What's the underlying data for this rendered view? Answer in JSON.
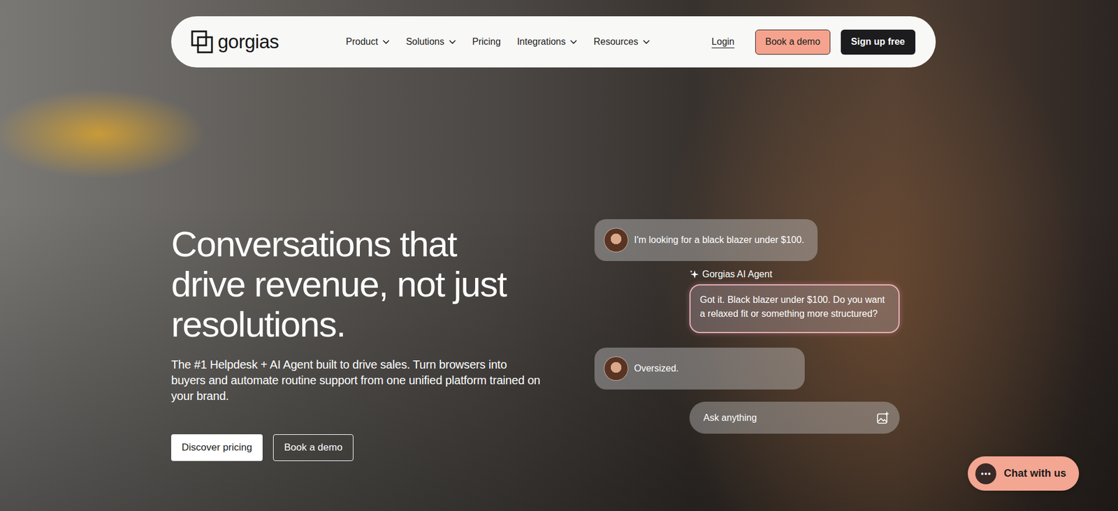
{
  "logo": {
    "text": "gorgias"
  },
  "nav": {
    "items": [
      {
        "label": "Product",
        "has_menu": true
      },
      {
        "label": "Solutions",
        "has_menu": true
      },
      {
        "label": "Pricing",
        "has_menu": false
      },
      {
        "label": "Integrations",
        "has_menu": true
      },
      {
        "label": "Resources",
        "has_menu": true
      }
    ],
    "login": "Login",
    "demo": "Book a demo",
    "signup": "Sign up free"
  },
  "hero": {
    "headline_lines": [
      "Conversations that",
      "drive revenue, not just",
      "resolutions."
    ],
    "subtitle": "The #1 Helpdesk + AI Agent built to drive sales. Turn browsers into buyers and automate routine support from one unified platform trained on your brand.",
    "buttons": [
      "Discover pricing",
      "Book a demo"
    ]
  },
  "chat_demo": {
    "messages": [
      {
        "kind": "user",
        "text": "I'm looking for a black blazer under $100."
      },
      {
        "kind": "agent",
        "label": "Gorgias AI Agent",
        "text": "Got it. Black blazer under $100. Do you want a relaxed fit or something more structured?"
      },
      {
        "kind": "user",
        "text": "Oversized."
      }
    ],
    "input": {
      "placeholder": "Ask anything"
    }
  },
  "chat_widget": {
    "label": "Chat with us"
  }
}
